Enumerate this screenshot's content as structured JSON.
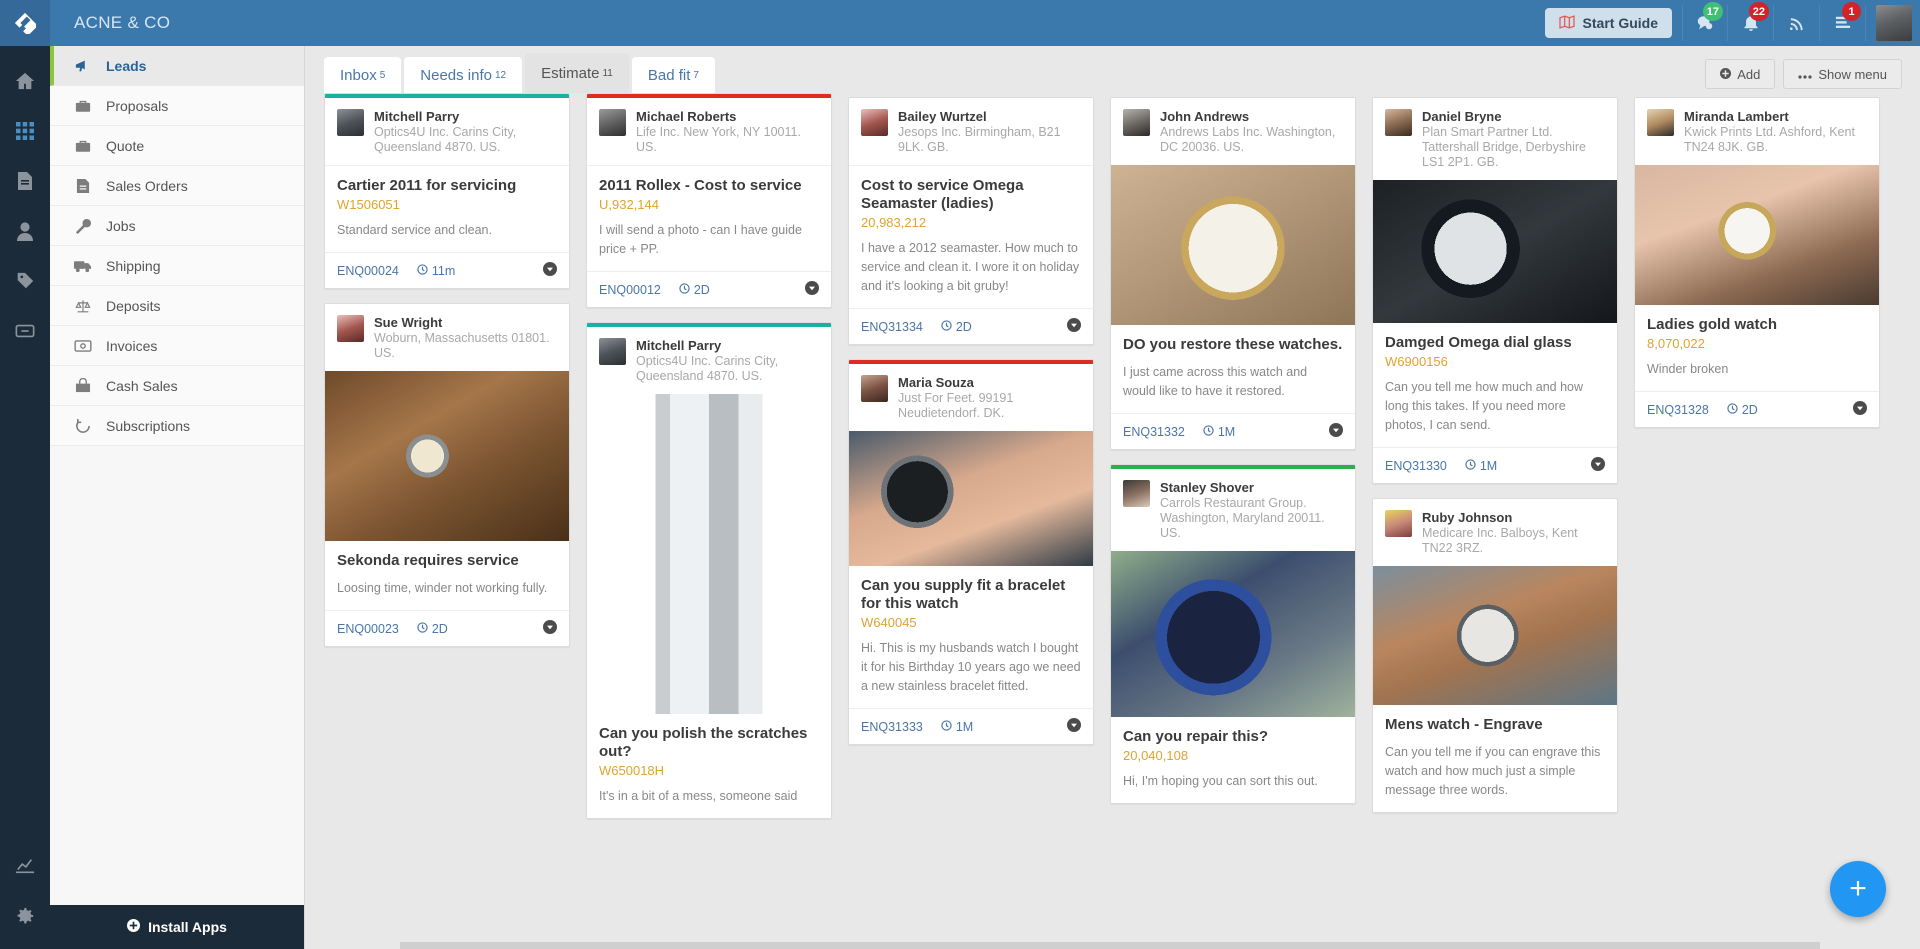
{
  "topbar": {
    "brand": "ACNE & CO",
    "start_guide_label": "Start Guide",
    "icons": [
      {
        "name": "chat-icon",
        "badge": "17",
        "badge_color": "#3fbf73"
      },
      {
        "name": "bell-icon",
        "badge": "22",
        "badge_color": "#d0242a"
      },
      {
        "name": "rss-icon",
        "badge": ""
      },
      {
        "name": "tasks-icon",
        "badge": "1",
        "badge_color": "#d0242a"
      }
    ]
  },
  "rail": {
    "items": [
      {
        "name": "home-icon"
      },
      {
        "name": "grid-icon"
      },
      {
        "name": "document-icon"
      },
      {
        "name": "user-icon"
      },
      {
        "name": "tag-icon"
      },
      {
        "name": "drawer-icon"
      }
    ],
    "settings": {
      "name": "gear-icon"
    },
    "reports": {
      "name": "chart-icon"
    }
  },
  "sidebar": {
    "items": [
      {
        "label": "Leads",
        "icon": "megaphone-icon",
        "active": true
      },
      {
        "label": "Proposals",
        "icon": "briefcase-icon",
        "active": false
      },
      {
        "label": "Quote",
        "icon": "briefcase-icon",
        "active": false
      },
      {
        "label": "Sales Orders",
        "icon": "file-icon",
        "active": false
      },
      {
        "label": "Jobs",
        "icon": "wrench-icon",
        "active": false
      },
      {
        "label": "Shipping",
        "icon": "truck-icon",
        "active": false
      },
      {
        "label": "Deposits",
        "icon": "scales-icon",
        "active": false
      },
      {
        "label": "Invoices",
        "icon": "money-icon",
        "active": false
      },
      {
        "label": "Cash Sales",
        "icon": "cash-icon",
        "active": false
      },
      {
        "label": "Subscriptions",
        "icon": "refresh-icon",
        "active": false
      }
    ],
    "install_apps_label": "Install Apps"
  },
  "tabs": [
    {
      "label": "Inbox",
      "count": "5",
      "active": false
    },
    {
      "label": "Needs info",
      "count": "12",
      "active": false
    },
    {
      "label": "Estimate",
      "count": "11",
      "active": true
    },
    {
      "label": "Bad fit",
      "count": "7",
      "active": false
    }
  ],
  "actions": {
    "add_label": "Add",
    "show_menu_label": "Show menu"
  },
  "fab_label": "+",
  "columns": [
    {
      "cards": [
        {
          "stripe": "#17b2a4",
          "avatar": "av1",
          "name": "Mitchell Parry",
          "org": "Optics4U Inc. Carins City, Queensland 4870. US.",
          "photo": null,
          "title": "Cartier 2011 for servicing",
          "ref": "W1506051",
          "desc": "Standard service and clean.",
          "enq": "ENQ00024",
          "time": "11m"
        },
        {
          "stripe": null,
          "avatar": "av3",
          "name": "Sue Wright",
          "org": "Woburn, Massachusetts 01801. US.",
          "photo": "ph-watch-brown",
          "title": "Sekonda requires service",
          "ref": null,
          "desc": "Loosing time, winder not working fully.",
          "enq": "ENQ00023",
          "time": "2D"
        }
      ]
    },
    {
      "cards": [
        {
          "stripe": "#e02b20",
          "avatar": "av2",
          "name": "Michael Roberts",
          "org": "Life Inc. New York, NY 10011. US.",
          "photo": null,
          "title": "2011 Rollex - Cost to service",
          "ref": "U,932,144",
          "desc": "I will send a photo - can I have guide price + PP.",
          "enq": "ENQ00012",
          "time": "2D"
        },
        {
          "stripe": "#17b2a4",
          "avatar": "av1",
          "name": "Mitchell Parry",
          "org": "Optics4U Inc. Carins City, Queensland 4870. US.",
          "photo": "ph-bracelet",
          "photo_tall": true,
          "title": "Can you polish the scratches out?",
          "ref": "W650018H",
          "desc": "It's in a bit of a mess, someone said",
          "enq": null,
          "time": null
        }
      ]
    },
    {
      "cards": [
        {
          "stripe": null,
          "avatar": "av3",
          "name": "Bailey Wurtzel",
          "org": "Jesops Inc. Birmingham, B21 9LK. GB.",
          "photo": null,
          "title": "Cost to service Omega Seamaster (ladies)",
          "ref": "20,983,212",
          "desc": "I have a 2012 seamaster. How much to service and clean it. I wore it on holiday and it's looking a bit gruby!",
          "enq": "ENQ31334",
          "time": "2D"
        },
        {
          "stripe": "#e02b20",
          "avatar": "av8",
          "name": "Maria Souza",
          "org": "Just For Feet. 99191 Neudietendorf. DK.",
          "photo": "ph-seamaster-hand",
          "title": "Can you supply fit a bracelet for this watch",
          "ref": "W640045",
          "desc": "Hi. This is my husbands watch I bought it for his Birthday 10 years ago we need a new stainless bracelet fitted.",
          "enq": "ENQ31333",
          "time": "1M"
        }
      ]
    },
    {
      "cards": [
        {
          "stripe": null,
          "avatar": "av4",
          "name": "John Andrews",
          "org": "Andrews Labs Inc. Washington, DC 20036. US.",
          "photo": "ph-rolex-gold",
          "photo_tall": true,
          "title": "DO you restore these watches.",
          "ref": null,
          "desc": "I just came across this watch and would like to have it restored.",
          "enq": "ENQ31332",
          "time": "1M"
        },
        {
          "stripe": "#29b24a",
          "avatar": "av7",
          "name": "Stanley Shover",
          "org": "Carrols Restaurant Group. Washington, Maryland 20011. US.",
          "photo": "ph-blue-diver",
          "photo_tall": true,
          "title": "Can you repair this?",
          "ref": "20,040,108",
          "desc": "Hi, I'm hoping you can sort this out.",
          "enq": null,
          "time": null
        }
      ]
    },
    {
      "cards": [
        {
          "stripe": null,
          "avatar": "av5",
          "name": "Daniel Bryne",
          "org": "Plan Smart Partner Ltd. Tattershall Bridge, Derbyshire LS1 2P1. GB.",
          "photo": "ph-smashed",
          "title": "Damged Omega dial glass",
          "ref": "W6900156",
          "desc": "Can you tell me how much and how long this takes. If you need more photos, I can send.",
          "enq": "ENQ31330",
          "time": "1M"
        },
        {
          "stripe": null,
          "avatar": "av9",
          "name": "Ruby Johnson",
          "org": "Medicare Inc. Balboys, Kent TN22 3RZ.",
          "photo": "ph-cartier-blue",
          "title": "Mens watch - Engrave",
          "ref": null,
          "desc": "Can you tell me if you can engrave this watch and how much just a simple message three words.",
          "enq": null,
          "time": null
        }
      ]
    },
    {
      "cards": [
        {
          "stripe": null,
          "avatar": "av10",
          "name": "Miranda Lambert",
          "org": "Kwick Prints Ltd. Ashford, Kent TN24 8JK. GB.",
          "photo": "ph-gold-hand",
          "title": "Ladies gold watch",
          "ref": "8,070,022",
          "desc": "Winder broken",
          "enq": "ENQ31328",
          "time": "2D"
        }
      ]
    }
  ]
}
